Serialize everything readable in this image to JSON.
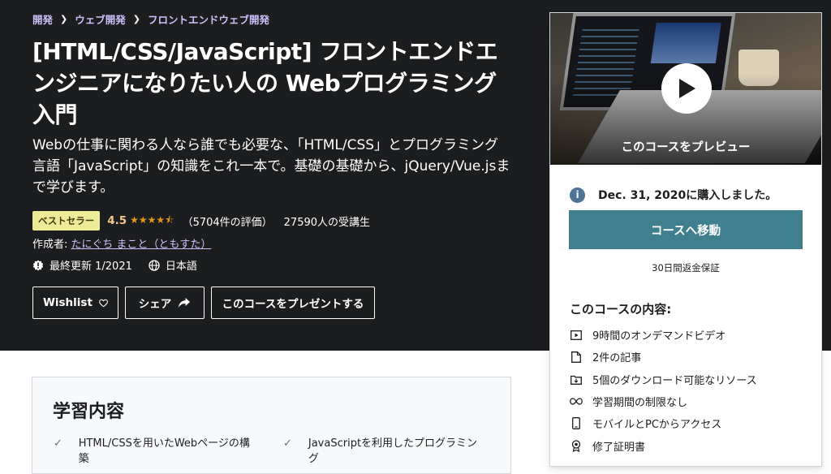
{
  "breadcrumb": [
    "開発",
    "ウェブ開発",
    "フロントエンドウェブ開発"
  ],
  "course": {
    "title": "[HTML/CSS/JavaScript] フロントエンドエンジニアになりたい人の Webプログラミング入門",
    "subtitle": "Webの仕事に関わる人なら誰でも必要な、「HTML/CSS」とプログラミング言語「JavaScript」の知識をこれ一本で。基礎の基礎から、jQuery/Vue.jsまで学びます。",
    "badge": "ベストセラー",
    "rating": "4.5",
    "rating_count": "（5704件の評価）",
    "students": "27590人の受講生",
    "author_label": "作成者: ",
    "author": "たにぐち まこと（ともすた）",
    "last_updated": "最終更新 1/2021",
    "language": "日本語"
  },
  "buttons": {
    "wishlist": "Wishlist",
    "share": "シェア",
    "gift": "このコースをプレゼントする"
  },
  "sidebar": {
    "preview_label": "このコースをプレビュー",
    "purchased": "Dec. 31, 2020に購入しました。",
    "go_button": "コースへ移動",
    "guarantee": "30日間返金保証",
    "includes_title": "このコースの内容:",
    "includes": [
      {
        "icon": "video-icon",
        "label": "9時間のオンデマンドビデオ"
      },
      {
        "icon": "file-icon",
        "label": "2件の記事"
      },
      {
        "icon": "download-icon",
        "label": "5個のダウンロード可能なリソース"
      },
      {
        "icon": "infinity-icon",
        "label": "学習期間の制限なし"
      },
      {
        "icon": "mobile-icon",
        "label": "モバイルとPCからアクセス"
      },
      {
        "icon": "certificate-icon",
        "label": "修了証明書"
      }
    ]
  },
  "learn": {
    "title": "学習内容",
    "items": [
      "HTML/CSSを用いたWebページの構築",
      "JavaScriptを利用したプログラミング"
    ]
  },
  "colors": {
    "hero_bg": "#1c1d1f",
    "link_purple": "#cec0fc",
    "badge_bg": "#eceb98",
    "rating_orange": "#e59819",
    "go_button_bg": "#3f7f8e"
  }
}
